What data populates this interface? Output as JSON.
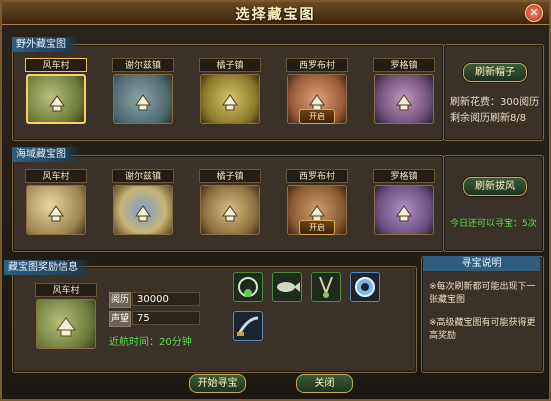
{
  "window": {
    "title": "选择藏宝图",
    "close_glyph": "✕"
  },
  "wild_section": {
    "label": "野外藏宝图",
    "maps": [
      {
        "name": "风车村",
        "icon": "village-map",
        "selected": true,
        "open_label": ""
      },
      {
        "name": "谢尔兹镇",
        "icon": "town-map",
        "selected": false,
        "open_label": ""
      },
      {
        "name": "橘子镇",
        "icon": "town-map",
        "selected": false,
        "open_label": ""
      },
      {
        "name": "西罗布村",
        "icon": "village-map",
        "selected": false,
        "open_label": "开启"
      },
      {
        "name": "罗格镇",
        "icon": "castle-map",
        "selected": false,
        "open_label": ""
      }
    ],
    "refresh_button": "刷新帽子",
    "cost_text": "刷新花费：300阅历",
    "remaining_text": "剩余阅历刷新8/8"
  },
  "sea_section": {
    "label": "海域藏宝图",
    "maps": [
      {
        "name": "风车村",
        "icon": "sea-map",
        "selected": false,
        "open_label": ""
      },
      {
        "name": "谢尔兹镇",
        "icon": "sea-map",
        "selected": false,
        "open_label": ""
      },
      {
        "name": "橘子镇",
        "icon": "sea-map",
        "selected": false,
        "open_label": ""
      },
      {
        "name": "西罗布村",
        "icon": "sea-map",
        "selected": false,
        "open_label": "开启"
      },
      {
        "name": "罗格镇",
        "icon": "sea-map",
        "selected": false,
        "open_label": ""
      }
    ],
    "refresh_button": "刷新拔风",
    "today_text": "今日还可以寻宝：5次"
  },
  "reward_section": {
    "label": "藏宝图奖励信息",
    "map_name": "风车村",
    "exp_label": "阅历",
    "exp_value": "30000",
    "fame_label": "声望",
    "fame_value": "75",
    "sail_time": "近航时间：20分钟",
    "items": [
      "necklace-icon",
      "fish-icon",
      "scissor-icon",
      "ring-icon",
      "sword-icon"
    ]
  },
  "help_section": {
    "title": "寻宝说明",
    "line1": "※每次刷新都可能出现下一张藏宝图",
    "line2": "※高级藏宝图有可能获得更高奖励"
  },
  "footer": {
    "start_button": "开始寻宝",
    "close_button": "关闭"
  },
  "colors": {
    "accent": "#c9a55a",
    "highlight": "#59e04a",
    "title": "#fff3c0"
  }
}
